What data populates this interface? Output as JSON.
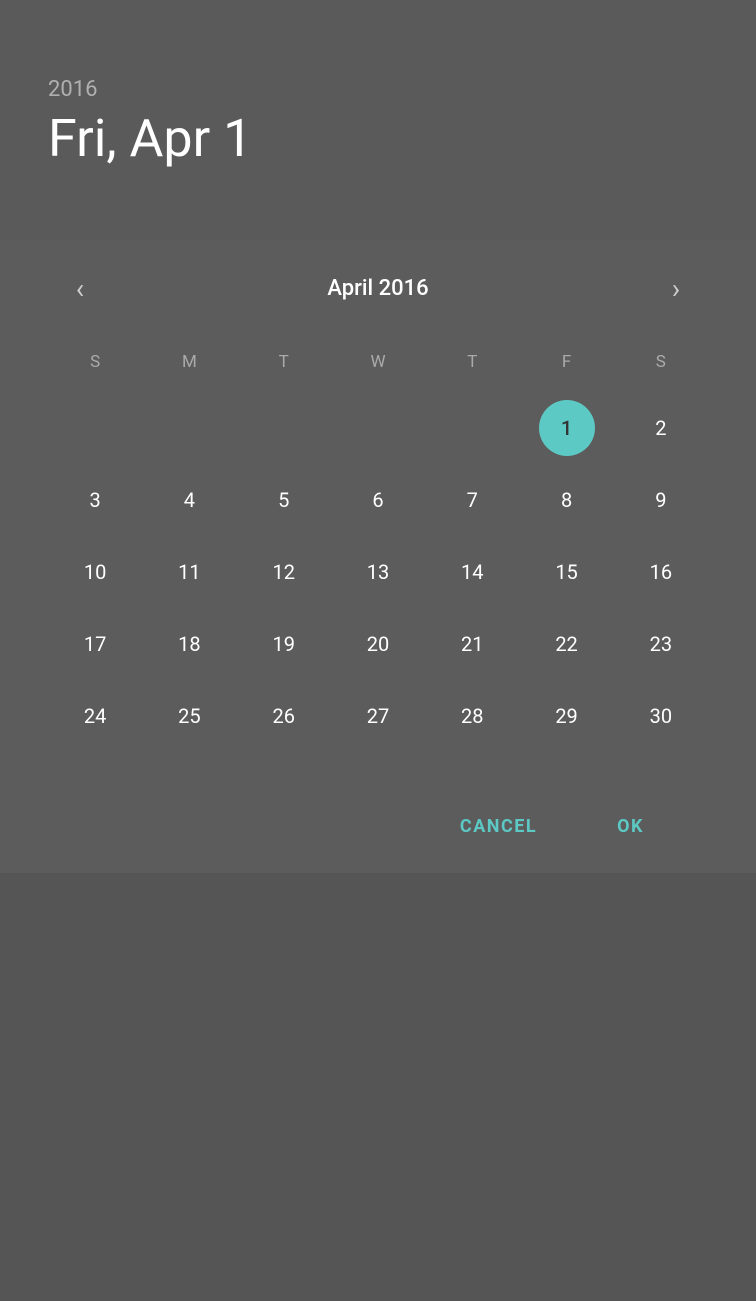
{
  "header": {
    "year": "2016",
    "date": "Fri, Apr 1"
  },
  "calendar": {
    "month_title": "April 2016",
    "day_headers": [
      "S",
      "M",
      "T",
      "W",
      "T",
      "F",
      "S"
    ],
    "selected_day": 1,
    "accent_color": "#5cc9c5",
    "weeks": [
      [
        null,
        null,
        null,
        null,
        null,
        1,
        2
      ],
      [
        3,
        4,
        5,
        6,
        7,
        8,
        9
      ],
      [
        10,
        11,
        12,
        13,
        14,
        15,
        16
      ],
      [
        17,
        18,
        19,
        20,
        21,
        22,
        23
      ],
      [
        24,
        25,
        26,
        27,
        28,
        29,
        30
      ]
    ]
  },
  "footer": {
    "cancel_label": "CANCEL",
    "ok_label": "OK"
  },
  "nav": {
    "prev_arrow": "‹",
    "next_arrow": "›"
  }
}
